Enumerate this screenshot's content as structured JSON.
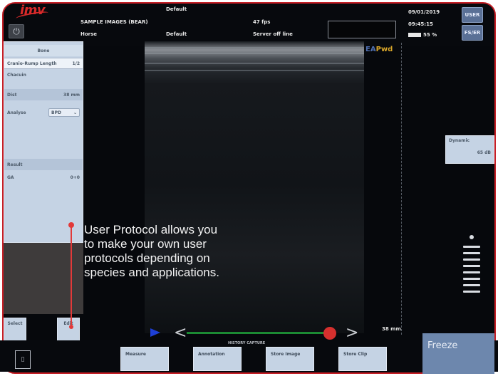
{
  "topbar": {
    "logo_text": "imv",
    "home_icon": "power-icon",
    "preset_top": "Default",
    "patient_id": "SAMPLE IMAGES (BEAR)",
    "patient_name": "Horse",
    "preset": "Default",
    "depth": "47 fps",
    "server_status": "Server off line",
    "date": "09/01/2019",
    "time": "09:45:15",
    "battery": "55 %",
    "btn_user": "USER",
    "btn_fs": "FS/ER"
  },
  "left_panel": {
    "header": "Bone",
    "row1_label": "Cranio-Rump Length",
    "row1_value": "1/2",
    "row2_label": "Chacuin",
    "dist_label": "Dist",
    "dist_value": "38 mm",
    "analyze_label": "Analyse",
    "analyze_select": "BPD",
    "result_label": "Result",
    "result_row_label": "GA",
    "result_row_value": "0+0",
    "btn_left": "Select",
    "btn_right": "Edit"
  },
  "image": {
    "mode_ea": "EA",
    "mode_pw": "Pwd"
  },
  "right_panel": {
    "dynamic_label": "Dynamic",
    "dynamic_value": "65 dB",
    "scale_text": "38 mm",
    "cine_label": "HISTORY CAPTURE"
  },
  "bottom": {
    "btn_measure": "Measure",
    "btn_annotation": "Annotation",
    "btn_store_image": "Store Image",
    "btn_store_clip": "Store Clip",
    "btn_freeze": "Freeze",
    "doc_icon": "document-icon"
  },
  "callout": {
    "text": "User Protocol allows you\nto make your own user\nprotocols depending on\nspecies and applications."
  },
  "colors": {
    "frame": "#c61f26",
    "panel": "#c5d3e4",
    "freeze": "#6d87ad",
    "cine_track": "#1b8a33",
    "cine_knob": "#d5302e",
    "play": "#1d3fd6"
  }
}
